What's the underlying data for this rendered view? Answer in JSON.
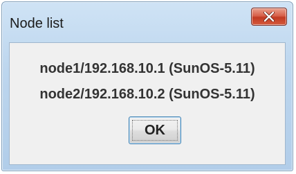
{
  "window": {
    "title": "Node list"
  },
  "titlebar": {
    "close_icon": "close-icon",
    "close_color": "#c8422a"
  },
  "nodes": [
    "node1/192.168.10.1 (SunOS-5.11)",
    "node2/192.168.10.2 (SunOS-5.11)"
  ],
  "buttons": {
    "ok_label": "OK"
  }
}
